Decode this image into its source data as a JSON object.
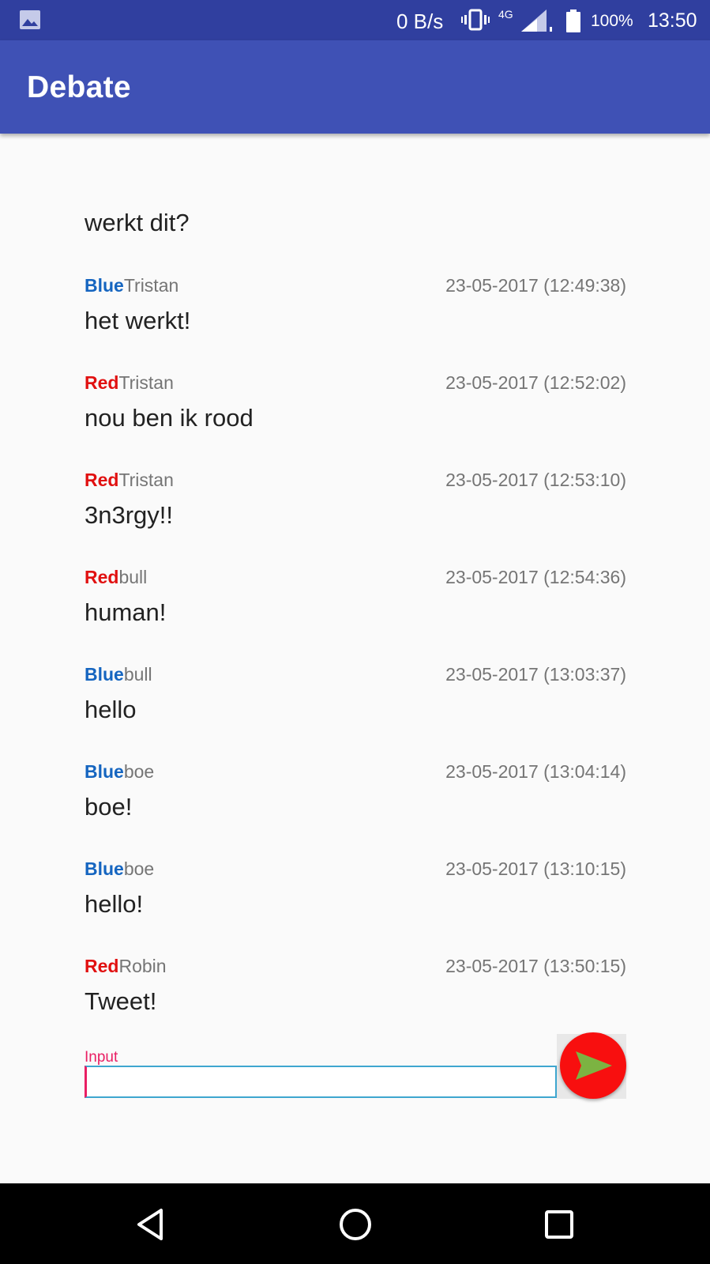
{
  "status_bar": {
    "net_speed": "0 B/s",
    "net_type": "4G",
    "battery": "100%",
    "time": "13:50",
    "icons": [
      "gallery-icon",
      "vibrate-icon",
      "signal-icon",
      "battery-icon"
    ]
  },
  "app_bar": {
    "title": "Debate"
  },
  "first_message": {
    "text": "werkt dit?"
  },
  "messages": [
    {
      "team": "Blue",
      "author": "Tristan",
      "timestamp": "23-05-2017 (12:49:38)",
      "text": "het werkt!"
    },
    {
      "team": "Red",
      "author": "Tristan",
      "timestamp": "23-05-2017 (12:52:02)",
      "text": "nou ben ik rood"
    },
    {
      "team": "Red",
      "author": "Tristan",
      "timestamp": "23-05-2017 (12:53:10)",
      "text": "3n3rgy!!"
    },
    {
      "team": "Red",
      "author": "bull",
      "timestamp": "23-05-2017 (12:54:36)",
      "text": "human!"
    },
    {
      "team": "Blue",
      "author": "bull",
      "timestamp": "23-05-2017 (13:03:37)",
      "text": "hello"
    },
    {
      "team": "Blue",
      "author": "boe",
      "timestamp": "23-05-2017 (13:04:14)",
      "text": "boe!"
    },
    {
      "team": "Blue",
      "author": "boe",
      "timestamp": "23-05-2017 (13:10:15)",
      "text": "hello!"
    },
    {
      "team": "Red",
      "author": "Robin",
      "timestamp": "23-05-2017 (13:50:15)",
      "text": "Tweet!"
    }
  ],
  "composer": {
    "label": "Input",
    "value": "",
    "send_icon": "send-arrow-icon"
  },
  "colors": {
    "status_bar": "#303f9f",
    "app_bar": "#3f51b5",
    "blue_team": "#1565c0",
    "red_team": "#e11010",
    "accent": "#e91e63",
    "send_button": "#f80f0f",
    "send_arrow": "#7cb342"
  },
  "nav_bar": {
    "icons": [
      "back-icon",
      "home-icon",
      "recent-apps-icon"
    ]
  }
}
